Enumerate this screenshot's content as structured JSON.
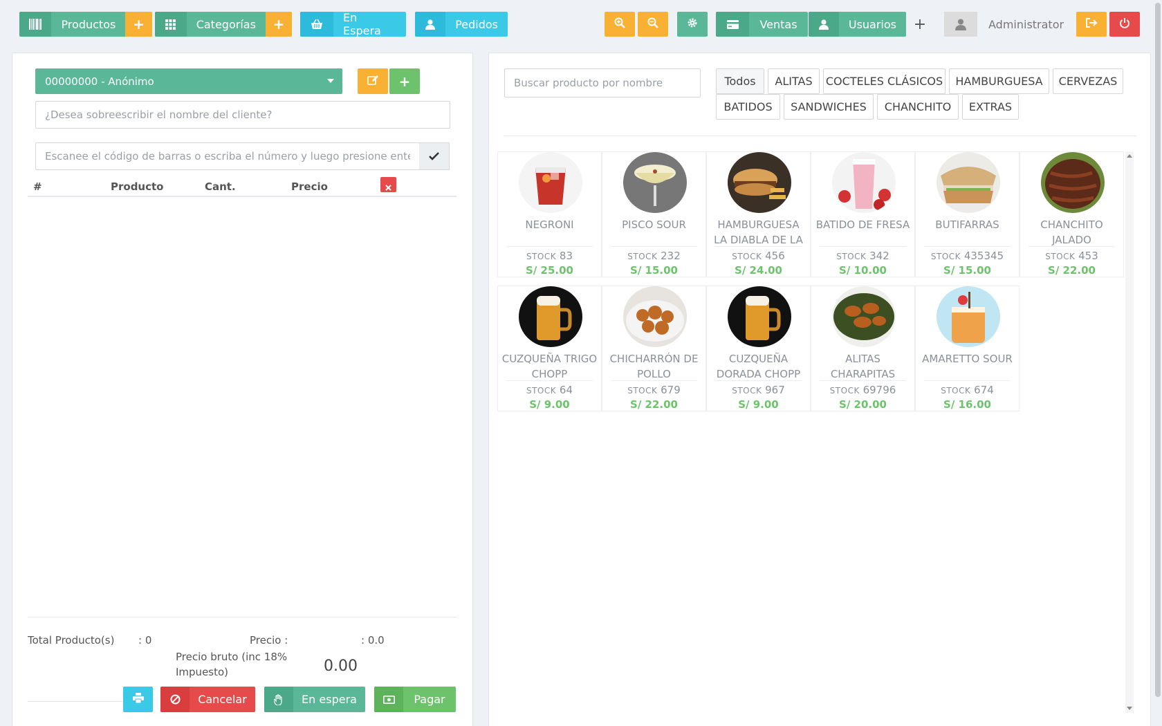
{
  "nav": {
    "productos": "Productos",
    "categorias": "Categorías",
    "en_espera": "En Espera",
    "pedidos": "Pedidos",
    "ventas": "Ventas",
    "usuarios": "Usuarios",
    "admin": "Administrator"
  },
  "order": {
    "client": "00000000 - Anónimo",
    "override_placeholder": "¿Desea sobreescribir el nombre del cliente?",
    "barcode_placeholder": "Escanee el código de barras o escriba el número y luego presione enter",
    "columns": [
      "#",
      "Producto",
      "Cant.",
      "Precio"
    ],
    "total_products_label": "Total Producto(s)",
    "total_products_value": ": 0",
    "price_label": "Precio :",
    "price_value": ": 0.0",
    "gross_label": "Precio bruto (inc 18% Impuesto)",
    "gross_value": "0.00",
    "cancel": "Cancelar",
    "hold": "En espera",
    "pay": "Pagar"
  },
  "catalog": {
    "search_placeholder": "Buscar producto por nombre",
    "categories": [
      "Todos",
      "ALITAS",
      "COCTELES CLÁSICOS",
      "HAMBURGUESA",
      "CERVEZAS",
      "BATIDOS",
      "SANDWICHES",
      "CHANCHITO",
      "EXTRAS"
    ],
    "stock_label": "STOCK",
    "products": [
      {
        "name": "NEGRONI",
        "stock": "83",
        "price": "S/ 25.00",
        "img": "cocktail-red"
      },
      {
        "name": "PISCO SOUR",
        "stock": "232",
        "price": "S/ 15.00",
        "img": "cocktail-sour"
      },
      {
        "name": "HAMBURGUESA LA DIABLA DE LA",
        "stock": "456",
        "price": "S/ 24.00",
        "img": "burger"
      },
      {
        "name": "BATIDO DE FRESA",
        "stock": "342",
        "price": "S/ 10.00",
        "img": "strawberry-shake"
      },
      {
        "name": "BUTIFARRAS",
        "stock": "435345",
        "price": "S/ 15.00",
        "img": "sandwich"
      },
      {
        "name": "CHANCHITO JALADO",
        "stock": "453",
        "price": "S/ 22.00",
        "img": "pork"
      },
      {
        "name": "CUZQUEÑA TRIGO CHOPP",
        "stock": "64",
        "price": "S/ 9.00",
        "img": "beer"
      },
      {
        "name": "CHICHARRÓN DE POLLO",
        "stock": "679",
        "price": "S/ 22.00",
        "img": "fried-chicken"
      },
      {
        "name": "CUZQUEÑA DORADA CHOPP",
        "stock": "967",
        "price": "S/ 9.00",
        "img": "beer"
      },
      {
        "name": "ALITAS CHARAPITAS",
        "stock": "69796",
        "price": "S/ 20.00",
        "img": "wings"
      },
      {
        "name": "AMARETTO SOUR",
        "stock": "674",
        "price": "S/ 16.00",
        "img": "amaretto"
      }
    ]
  },
  "colors": {
    "teal": "#5ab899",
    "cyan": "#3ac9e6",
    "orange": "#f9b133",
    "red": "#e64a4a",
    "green": "#6cc36b"
  }
}
